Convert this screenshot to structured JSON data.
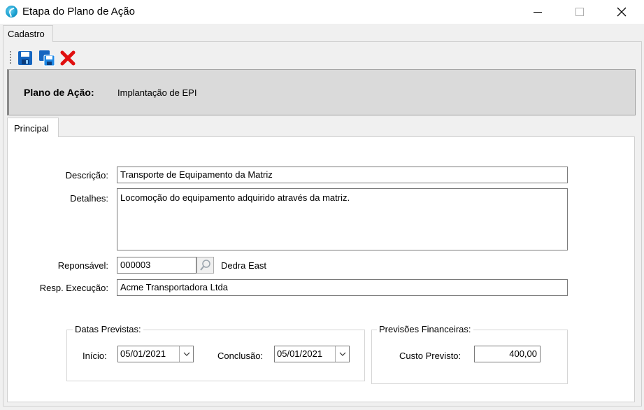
{
  "window": {
    "title": "Etapa do Plano de Ação"
  },
  "outer_tab": {
    "label": "Cadastro"
  },
  "header": {
    "plan_label": "Plano de Ação:",
    "plan_value": "Implantação de EPI"
  },
  "inner_tab": {
    "label": "Principal"
  },
  "form": {
    "descricao_label": "Descrição:",
    "descricao_value": "Transporte de Equipamento da Matriz",
    "detalhes_label": "Detalhes:",
    "detalhes_value": "Locomoção do equipamento adquirido através da matriz.",
    "responsavel_label": "Reponsável:",
    "responsavel_code": "000003",
    "responsavel_name": "Dedra East",
    "resp_execucao_label": "Resp. Execução:",
    "resp_execucao_value": "Acme Transportadora Ltda"
  },
  "datas": {
    "legend": "Datas Previstas:",
    "inicio_label": "Início:",
    "inicio_value": "05/01/2021",
    "conclusao_label": "Conclusão:",
    "conclusao_value": "05/01/2021"
  },
  "financeiras": {
    "legend": "Previsões Financeiras:",
    "custo_label": "Custo Previsto:",
    "custo_value": "400,00"
  },
  "icons": {
    "app": "app-logo-icon",
    "save": "save-icon",
    "save_all": "save-all-icon",
    "delete": "delete-icon",
    "lookup": "search-icon",
    "dropdown": "chevron-down-icon"
  }
}
